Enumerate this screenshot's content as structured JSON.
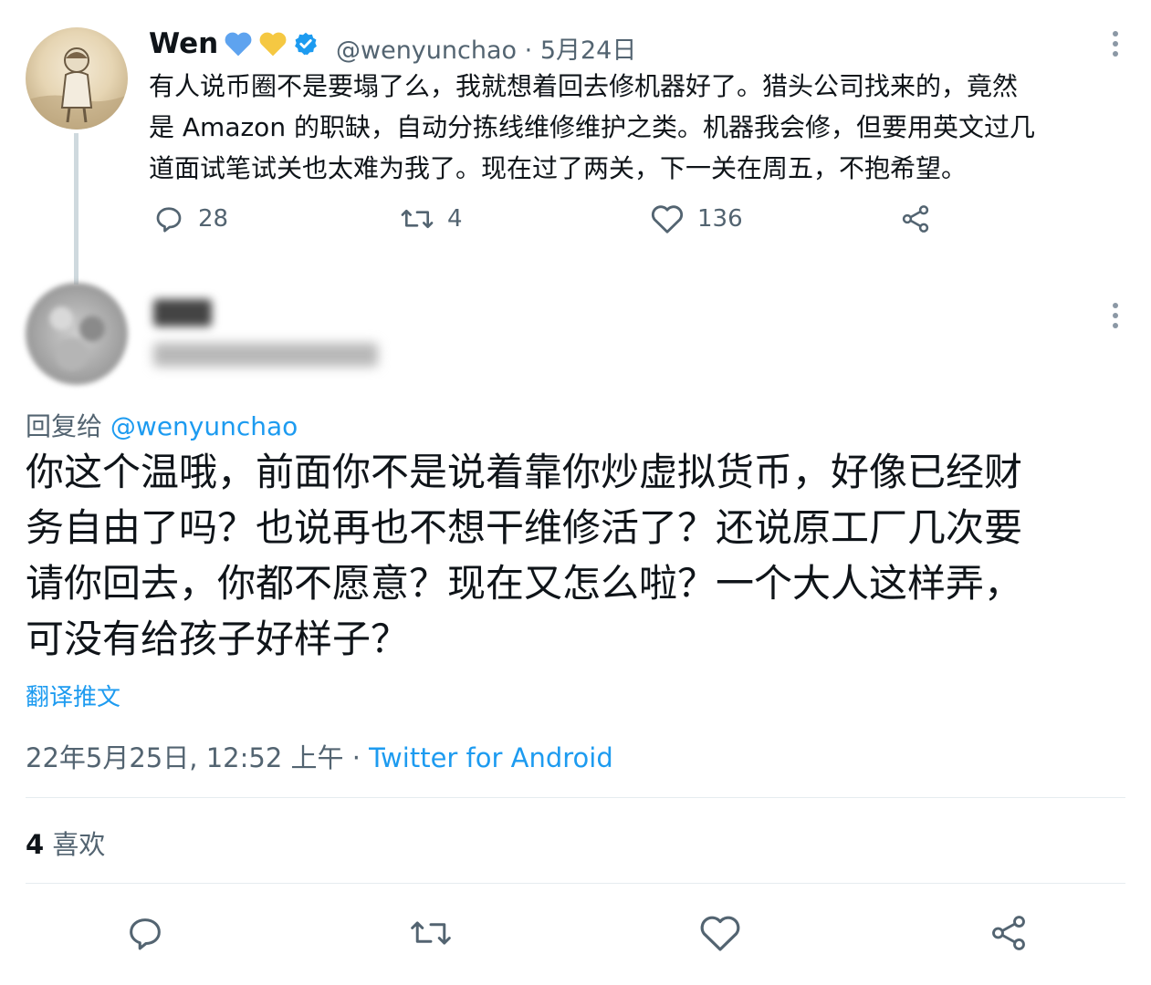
{
  "parent_tweet": {
    "author_name": "Wen",
    "badges": [
      "blue-heart-icon",
      "yellow-heart-icon",
      "verified-badge-icon"
    ],
    "handle": "@wenyunchao",
    "separator": "·",
    "date": "5月24日",
    "text_lines": [
      "有人说币圈不是要塌了么，我就想着回去修机器好了。猎头公司找来的，竟然",
      "是 Amazon 的职缺，自动分拣线维修维护之类。机器我会修，但要用英文过几",
      "道面试笔试关也太难为我了。现在过了两关，下一关在周五，不抱希望。"
    ],
    "reply_count": "28",
    "retweet_count": "4",
    "like_count": "136"
  },
  "reply_tweet": {
    "reply_to_label": "回复给",
    "reply_to_handle": "@wenyunchao",
    "text_lines": [
      "你这个温哦，前面你不是说着靠你炒虚拟货币，好像已经财",
      "务自由了吗？也说再也不想干维修活了？还说原工厂几次要",
      "请你回去，你都不愿意？现在又怎么啦？一个大人这样弄，",
      "可没有给孩子好样子？"
    ],
    "translate_label": "翻译推文",
    "timestamp": "22年5月25日, 12:52 上午",
    "meta_separator": "·",
    "client": "Twitter for Android",
    "likes_count": "4",
    "likes_label": "喜欢"
  },
  "colors": {
    "accent": "#1d9bf0",
    "secondary_text": "#536471",
    "primary_text": "#0f1419",
    "divider": "#e6ecf0",
    "blue_heart": "#5ea3ef",
    "yellow_heart": "#f5c842"
  }
}
